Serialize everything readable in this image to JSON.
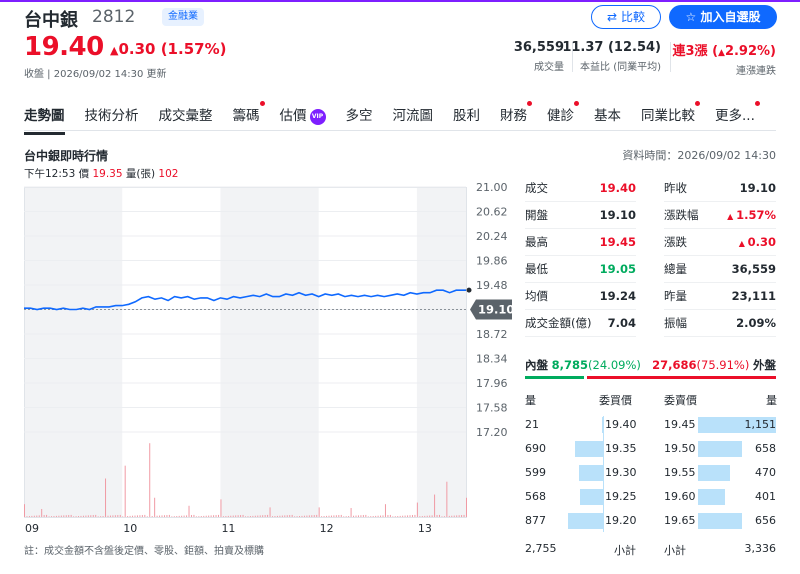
{
  "header": {
    "name": "台中銀",
    "code": "2812",
    "sector_badge": "金融業",
    "compare_label": "比較",
    "watchlist_label": "加入自選股",
    "price": "19.40",
    "change": "0.30 (1.57%)",
    "status": "收盤 | 2026/09/02 14:30 更新",
    "stats": [
      {
        "value": "36,559",
        "label": "成交量"
      },
      {
        "value": "11.37 (12.54)",
        "label": "本益比 (同業平均)"
      },
      {
        "value": "連3漲 (",
        "value2": "2.92%)",
        "label": "連漲連跌"
      }
    ]
  },
  "tabs": [
    {
      "label": "走勢圖",
      "active": true,
      "dot": false,
      "vip": false
    },
    {
      "label": "技術分析",
      "active": false,
      "dot": false,
      "vip": false
    },
    {
      "label": "成交彙整",
      "active": false,
      "dot": false,
      "vip": false
    },
    {
      "label": "籌碼",
      "active": false,
      "dot": true,
      "vip": false
    },
    {
      "label": "估價",
      "active": false,
      "dot": false,
      "vip": true
    },
    {
      "label": "多空",
      "active": false,
      "dot": false,
      "vip": false
    },
    {
      "label": "河流圖",
      "active": false,
      "dot": false,
      "vip": false
    },
    {
      "label": "股利",
      "active": false,
      "dot": false,
      "vip": false
    },
    {
      "label": "財務",
      "active": false,
      "dot": true,
      "vip": false
    },
    {
      "label": "健診",
      "active": false,
      "dot": true,
      "vip": false
    },
    {
      "label": "基本",
      "active": false,
      "dot": false,
      "vip": false
    },
    {
      "label": "同業比較",
      "active": false,
      "dot": true,
      "vip": false
    },
    {
      "label": "更多...",
      "active": false,
      "dot": true,
      "vip": false
    }
  ],
  "vip_label": "VIP",
  "chart_section": {
    "title": "台中銀即時行情",
    "data_time": "資料時間：2026/09/02 14:30",
    "tick_time": "下午12:53",
    "tick_price_label": "價",
    "tick_price": "19.35",
    "tick_vol_label": "量(張)",
    "tick_vol": "102",
    "note": "註：成交金額不含盤後定價、零股、鉅額、拍賣及標購"
  },
  "chart_data": {
    "type": "line",
    "x_ticks": [
      "09",
      "10",
      "11",
      "12",
      "13"
    ],
    "y_ticks": [
      "21.00",
      "20.62",
      "20.24",
      "19.86",
      "19.48",
      "19.10",
      "18.72",
      "18.34",
      "17.96",
      "17.58",
      "17.20"
    ],
    "ylim": [
      17.2,
      21.0
    ],
    "ref_price": 19.1,
    "ref_label": "19.10",
    "price_series": [
      [
        0,
        19.12
      ],
      [
        4,
        19.12
      ],
      [
        8,
        19.1
      ],
      [
        12,
        19.12
      ],
      [
        16,
        19.12
      ],
      [
        20,
        19.1
      ],
      [
        24,
        19.12
      ],
      [
        28,
        19.1
      ],
      [
        32,
        19.1
      ],
      [
        36,
        19.12
      ],
      [
        40,
        19.1
      ],
      [
        44,
        19.14
      ],
      [
        48,
        19.14
      ],
      [
        52,
        19.14
      ],
      [
        56,
        19.16
      ],
      [
        60,
        19.16
      ],
      [
        64,
        19.18
      ],
      [
        68,
        19.22
      ],
      [
        72,
        19.28
      ],
      [
        76,
        19.3
      ],
      [
        80,
        19.26
      ],
      [
        84,
        19.28
      ],
      [
        88,
        19.24
      ],
      [
        92,
        19.3
      ],
      [
        96,
        19.28
      ],
      [
        100,
        19.3
      ],
      [
        104,
        19.26
      ],
      [
        108,
        19.28
      ],
      [
        112,
        19.28
      ],
      [
        116,
        19.24
      ],
      [
        120,
        19.28
      ],
      [
        124,
        19.26
      ],
      [
        128,
        19.3
      ],
      [
        132,
        19.28
      ],
      [
        136,
        19.3
      ],
      [
        140,
        19.32
      ],
      [
        144,
        19.3
      ],
      [
        148,
        19.34
      ],
      [
        152,
        19.3
      ],
      [
        156,
        19.3
      ],
      [
        160,
        19.34
      ],
      [
        164,
        19.32
      ],
      [
        168,
        19.36
      ],
      [
        172,
        19.32
      ],
      [
        176,
        19.34
      ],
      [
        180,
        19.3
      ],
      [
        184,
        19.34
      ],
      [
        188,
        19.32
      ],
      [
        192,
        19.34
      ],
      [
        196,
        19.3
      ],
      [
        200,
        19.32
      ],
      [
        204,
        19.3
      ],
      [
        208,
        19.32
      ],
      [
        212,
        19.3
      ],
      [
        216,
        19.32
      ],
      [
        220,
        19.3
      ],
      [
        224,
        19.32
      ],
      [
        228,
        19.34
      ],
      [
        232,
        19.32
      ],
      [
        236,
        19.36
      ],
      [
        240,
        19.34
      ],
      [
        244,
        19.36
      ],
      [
        248,
        19.36
      ],
      [
        252,
        19.4
      ],
      [
        256,
        19.4
      ],
      [
        260,
        19.36
      ],
      [
        264,
        19.4
      ],
      [
        270,
        19.4
      ]
    ],
    "volume_spikes": [
      [
        0,
        40
      ],
      [
        10,
        25
      ],
      [
        50,
        120
      ],
      [
        62,
        160
      ],
      [
        76,
        230
      ],
      [
        80,
        60
      ],
      [
        100,
        35
      ],
      [
        120,
        55
      ],
      [
        150,
        30
      ],
      [
        180,
        30
      ],
      [
        200,
        28
      ],
      [
        220,
        40
      ],
      [
        240,
        45
      ],
      [
        250,
        70
      ],
      [
        258,
        110
      ],
      [
        270,
        60
      ]
    ],
    "last_price": 19.4
  },
  "quote_table": [
    {
      "label": "成交",
      "value": "19.40",
      "color": "red",
      "label2": "昨收",
      "value2": "19.10",
      "color2": ""
    },
    {
      "label": "開盤",
      "value": "19.10",
      "color": "",
      "label2": "漲跌幅",
      "value2": "1.57%",
      "color2": "red-up"
    },
    {
      "label": "最高",
      "value": "19.45",
      "color": "red",
      "label2": "漲跌",
      "value2": "0.30",
      "color2": "red-up"
    },
    {
      "label": "最低",
      "value": "19.05",
      "color": "green",
      "label2": "總量",
      "value2": "36,559",
      "color2": ""
    },
    {
      "label": "均價",
      "value": "19.24",
      "color": "",
      "label2": "昨量",
      "value2": "23,111",
      "color2": ""
    },
    {
      "label": "成交金額(億)",
      "value": "7.04",
      "color": "",
      "label2": "振幅",
      "value2": "2.09%",
      "color2": ""
    }
  ],
  "inner_outer": {
    "inner_label": "內盤",
    "inner_value": "8,785",
    "inner_pct": "(24.09%)",
    "inner_ratio": 0.2409,
    "outer_value": "27,686",
    "outer_pct": "(75.91%)",
    "outer_label": "外盤"
  },
  "order_book": {
    "bid_vol_header": "量",
    "bid_price_header": "委買價",
    "ask_price_header": "委賣價",
    "ask_vol_header": "量",
    "bids": [
      {
        "volume": "21",
        "price": "19.40",
        "ratio": 0.02
      },
      {
        "volume": "690",
        "price": "19.35",
        "ratio": 0.6
      },
      {
        "volume": "599",
        "price": "19.30",
        "ratio": 0.52
      },
      {
        "volume": "568",
        "price": "19.25",
        "ratio": 0.49
      },
      {
        "volume": "877",
        "price": "19.20",
        "ratio": 0.76
      }
    ],
    "asks": [
      {
        "price": "19.45",
        "volume": "1,151",
        "ratio": 1.0
      },
      {
        "price": "19.50",
        "volume": "658",
        "ratio": 0.57
      },
      {
        "price": "19.55",
        "volume": "470",
        "ratio": 0.41
      },
      {
        "price": "19.60",
        "volume": "401",
        "ratio": 0.35
      },
      {
        "price": "19.65",
        "volume": "656",
        "ratio": 0.57
      }
    ],
    "bid_total": "2,755",
    "bid_total_label": "小計",
    "ask_total_label": "小計",
    "ask_total": "3,336"
  },
  "colors": {
    "up": "#eb0f29",
    "down": "#00ab5e",
    "accent": "#0f69ff",
    "line": "#0f69ff"
  }
}
